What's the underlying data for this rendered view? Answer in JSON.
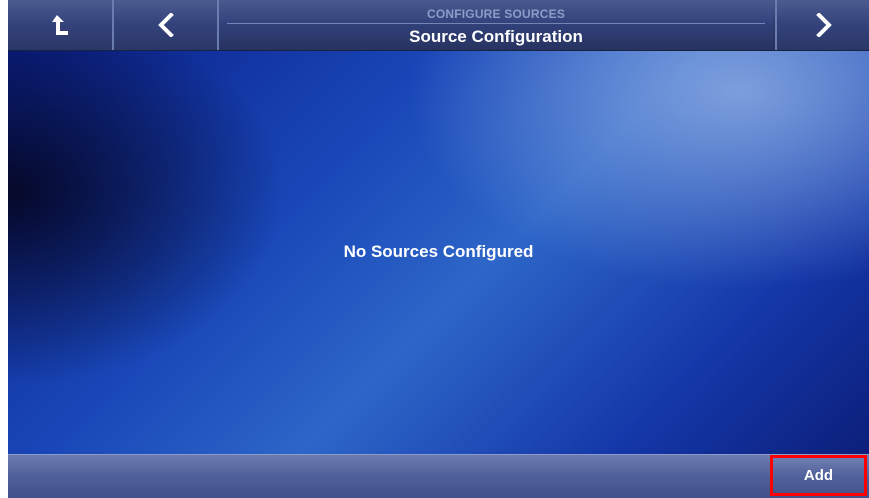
{
  "header": {
    "up_icon": "up-left-arrow-icon",
    "back_icon": "chevron-left-icon",
    "next_icon": "chevron-right-icon",
    "section_label": "CONFIGURE SOURCES",
    "title": "Source Configuration"
  },
  "main": {
    "empty_message": "No Sources Configured"
  },
  "footer": {
    "add_label": "Add",
    "highlight_color": "#ff0000"
  },
  "colors": {
    "header_bg": "#33427a",
    "main_accent": "#1947b8",
    "text": "#ffffff"
  }
}
